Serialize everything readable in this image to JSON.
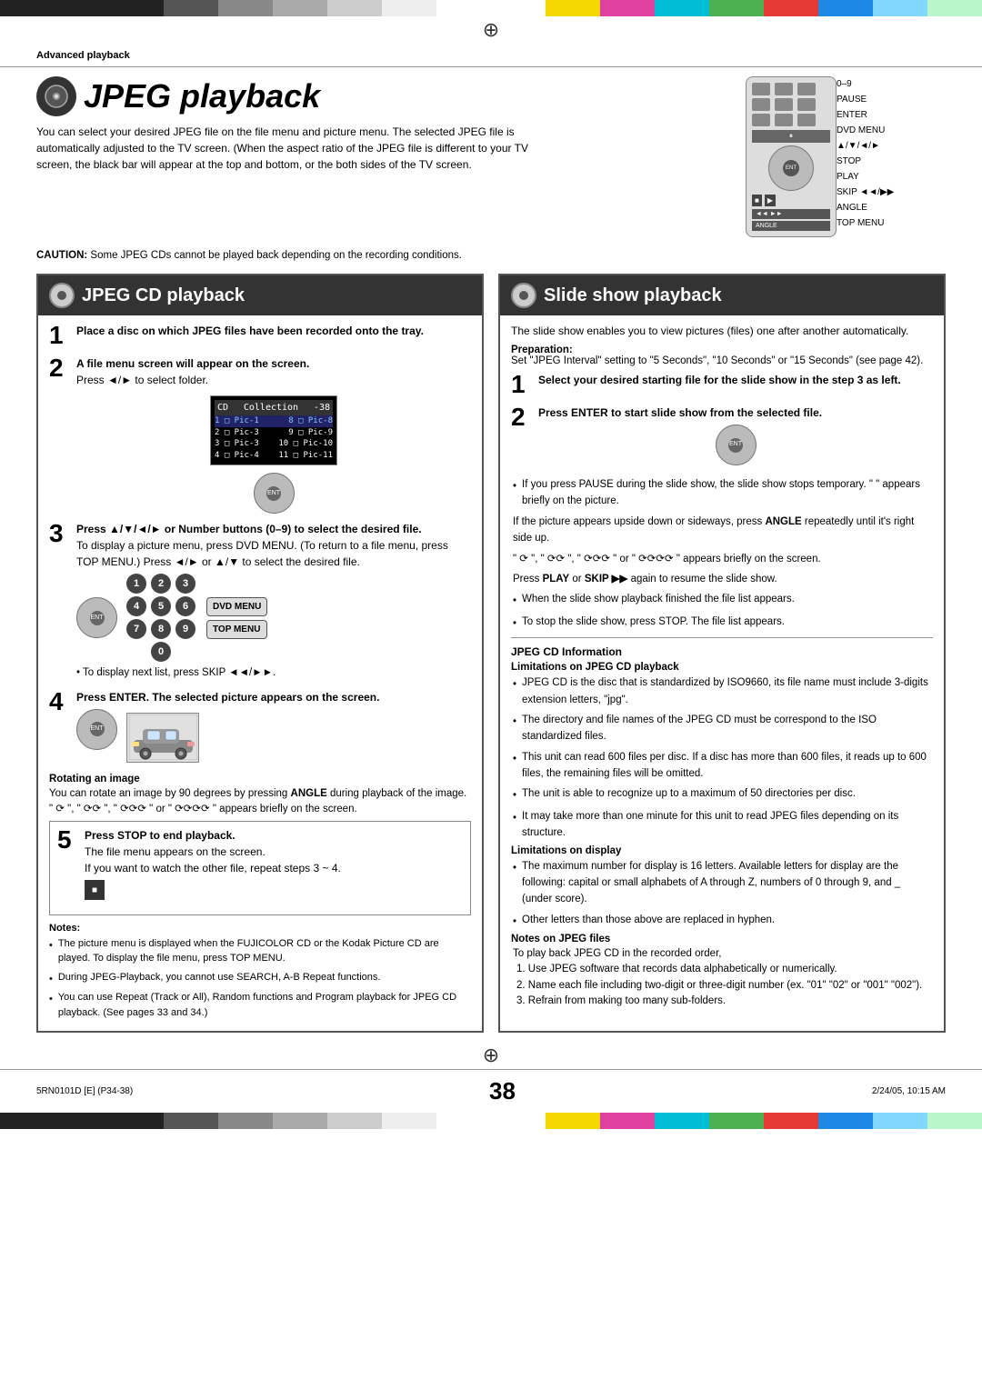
{
  "page": {
    "number": "38",
    "footer_left": "5RN0101D [E] (P34-38)",
    "footer_center": "38",
    "footer_right": "2/24/05, 10:15 AM"
  },
  "header": {
    "section_label": "Advanced playback"
  },
  "title": {
    "main": "JPEG playback",
    "intro": "You can select your desired JPEG file on the file menu and picture menu. The selected JPEG file is automatically adjusted to the TV screen. (When the aspect ratio of the JPEG file is different to your TV screen, the black bar will appear at the top and bottom, or the both sides of the TV screen."
  },
  "caution": {
    "title": "CAUTION:",
    "text": "Some JPEG CDs cannot be played back depending on the recording conditions."
  },
  "remote": {
    "labels": [
      "0–9",
      "PAUSE",
      "ENTER",
      "DVD MENU",
      "▲/▼/◄/►",
      "STOP",
      "PLAY",
      "SKIP ◄◄/►►",
      "ANGLE",
      "TOP MENU"
    ]
  },
  "left_section": {
    "title": "JPEG CD playback",
    "steps": [
      {
        "num": "1",
        "bold_text": "Place a disc on which JPEG files have been recorded onto the tray."
      },
      {
        "num": "2",
        "bold_text": "A file menu screen will appear on the screen.",
        "text": "Press ◄/► to select folder."
      },
      {
        "num": "3",
        "bold_text": "Press ▲/▼/◄/► or Number buttons (0–9) to select the desired file.",
        "extra": "To display a picture menu, press DVD MENU. (To return to a file menu, press TOP MENU.) Press ◄/► or ▲/▼ to select the desired file.",
        "bullet": "To display next list, press SKIP ◄◄/►►."
      },
      {
        "num": "4",
        "bold_text": "Press ENTER. The selected picture appears on the screen."
      }
    ],
    "rotating_image": {
      "title": "Rotating an image",
      "text": "You can rotate an image by 90 degrees by pressing ANGLE during playback of the image.",
      "symbols": "\"  \", \"  \", \"  \" or \"  \" appears briefly on the screen."
    },
    "step5": {
      "num": "5",
      "bold_text": "Press STOP to end playback.",
      "text": "The file menu appears on the screen.",
      "extra": "If you want to watch the other file, repeat steps 3 ~ 4."
    },
    "notes": {
      "title": "Notes:",
      "items": [
        "The picture menu is displayed when the FUJICOLOR CD or the Kodak Picture CD are played. To display the file menu, press TOP MENU.",
        "During JPEG-Playback, you cannot use SEARCH, A-B Repeat functions.",
        "You can use Repeat (Track or All), Random functions and Program playback for JPEG CD playback. (See pages 33 and 34.)"
      ]
    }
  },
  "right_section": {
    "title": "Slide show playback",
    "intro": "The slide show enables you to view pictures (files) one after another automatically.",
    "preparation": {
      "title": "Preparation:",
      "text": "Set \"JPEG Interval\" setting to \"5 Seconds\", \"10 Seconds\" or \"15 Seconds\" (see page 42)."
    },
    "steps": [
      {
        "num": "1",
        "bold_text": "Select your desired starting file for the slide show in the step 3 as left."
      },
      {
        "num": "2",
        "bold_text": "Press ENTER to start slide show from the selected file."
      }
    ],
    "bullets": [
      "If you press PAUSE during the slide show, the slide show stops temporary. \" \" appears briefly on the picture.",
      "If the picture appears upside down or sideways, press ANGLE repeatedly until it's right side up.",
      "\"  \", \"  \", \"  \" or \"  \" appears briefly on the screen.",
      "Press PLAY or SKIP ►► again to resume the slide show.",
      "When the slide show playback finished the file list appears.",
      "To stop the slide show, press STOP. The file list appears."
    ],
    "jpeg_cd_info": {
      "title": "JPEG CD Information",
      "limitations_playback_title": "Limitations on JPEG CD playback",
      "limitations_playback": [
        "JPEG CD is the disc that is standardized by ISO9660, its file name must include 3-digits extension letters, \"jpg\".",
        "The directory and file names of the JPEG CD must be correspond to the ISO standardized files.",
        "This unit can read 600 files per disc. If a disc has more than 600 files, it reads up to 600 files, the remaining files will be omitted.",
        "The unit is able to recognize up to a maximum of 50 directories per disc.",
        "It may take more than one minute for this unit to read JPEG files depending on its structure."
      ],
      "limitations_display_title": "Limitations on display",
      "limitations_display": [
        "The maximum number for display is 16 letters. Available letters for display are the following: capital or small alphabets of A through Z, numbers of 0 through 9, and _ (under score).",
        "Other letters than those above are replaced in hyphen."
      ],
      "notes_jpeg_title": "Notes on JPEG files",
      "notes_jpeg": [
        "To play back JPEG CD in the recorded order,",
        "1. Use JPEG software that records data alphabetically or numerically.",
        "2. Name each file including two-digit or three-digit number (ex. \"01\" \"02\" or \"001\" \"002\").",
        "3. Refrain from making too many sub-folders."
      ]
    }
  },
  "file_menu": {
    "header": "Collection",
    "counter": "-38",
    "rows": [
      {
        "num": "1",
        "icon": "□",
        "name": "Pic-1",
        "col2_num": "8",
        "col2_icon": "□",
        "col2_name": "Pic-8"
      },
      {
        "num": "2",
        "icon": "□",
        "name": "Pic-3",
        "col2_num": "9",
        "col2_icon": "□",
        "col2_name": "Pic-9"
      },
      {
        "num": "3",
        "icon": "□",
        "name": "Pic-3",
        "col2_num": "10",
        "col2_icon": "□",
        "col2_name": "Pic-10"
      },
      {
        "num": "4",
        "icon": "□",
        "name": "Pic-4",
        "col2_num": "11",
        "col2_icon": "□",
        "col2_name": "Pic-11"
      }
    ]
  }
}
